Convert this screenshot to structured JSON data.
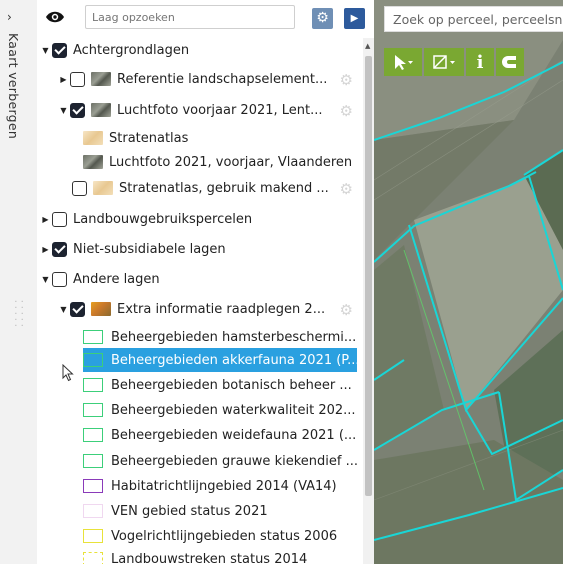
{
  "side_tab": {
    "collapse_glyph": "›",
    "label": "Kaart verbergen"
  },
  "layer_panel": {
    "search": {
      "placeholder": "Laag opzoeken"
    },
    "tree": [
      {
        "label": "Achtergrondlagen",
        "checked": true,
        "expanded": true,
        "icon": null
      },
      {
        "label": "Referentie landschapselement...",
        "checked": false,
        "expanded": false,
        "icon": "aerial-photo"
      },
      {
        "label": "Luchtfoto voorjaar 2021, Lent...",
        "checked": true,
        "expanded": true,
        "icon": "aerial-photo"
      },
      {
        "label": "Stratenatlas",
        "icon": "street-atlas"
      },
      {
        "label": "Luchtfoto 2021, voorjaar, Vlaanderen",
        "icon": "aerial-photo"
      },
      {
        "label": "Stratenatlas, gebruik makend ...",
        "checked": false,
        "icon": "street-atlas"
      },
      {
        "label": "Landbouwgebruikspercelen",
        "checked": false,
        "expanded": false
      },
      {
        "label": "Niet-subsidiabele lagen",
        "checked": true,
        "expanded": false
      },
      {
        "label": "Andere lagen",
        "checked": false,
        "expanded": true
      },
      {
        "label": "Extra informatie raadplegen 2...",
        "checked": true,
        "expanded": true,
        "icon": "extra-info"
      }
    ],
    "legend": [
      {
        "label": "Beheergebieden hamsterbeschermi...",
        "color": "#3ccf7a",
        "selected": false
      },
      {
        "label": "Beheergebieden akkerfauna 2021 (P...",
        "color": "#3ccf7a",
        "selected": true
      },
      {
        "label": "Beheergebieden botanisch beheer ...",
        "color": "#3ccf7a",
        "selected": false
      },
      {
        "label": "Beheergebieden waterkwaliteit 202...",
        "color": "#3ccf7a",
        "selected": false
      },
      {
        "label": "Beheergebieden weidefauna 2021 (...",
        "color": "#3ccf7a",
        "selected": false
      },
      {
        "label": "Beheergebieden grauwe kiekendief ...",
        "color": "#3ccf7a",
        "selected": false
      },
      {
        "label": "Habitatrichtlijngebied 2014 (VA14)",
        "color": "#8a3ab9",
        "selected": false
      },
      {
        "label": "VEN gebied status 2021",
        "color": "#f0d8f0",
        "selected": false
      },
      {
        "label": "Vogelrichtlijngebieden status 2006",
        "color": "#e8e23a",
        "selected": false
      },
      {
        "label": "Landbouwstreken status 2014",
        "color": "#e8e23a",
        "selected": false
      }
    ]
  },
  "map": {
    "search_placeholder": "Zoek op perceel, perceelsnr",
    "parcel_outline_color": "#19d6d6",
    "toolbar": [
      "select-arrow-icon",
      "measure-icon",
      "info-icon",
      "magnet-icon"
    ]
  },
  "colors": {
    "selection": "#2aa0e0",
    "toolbar_green": "#7aa832",
    "primary_button": "#2d5a9c"
  }
}
